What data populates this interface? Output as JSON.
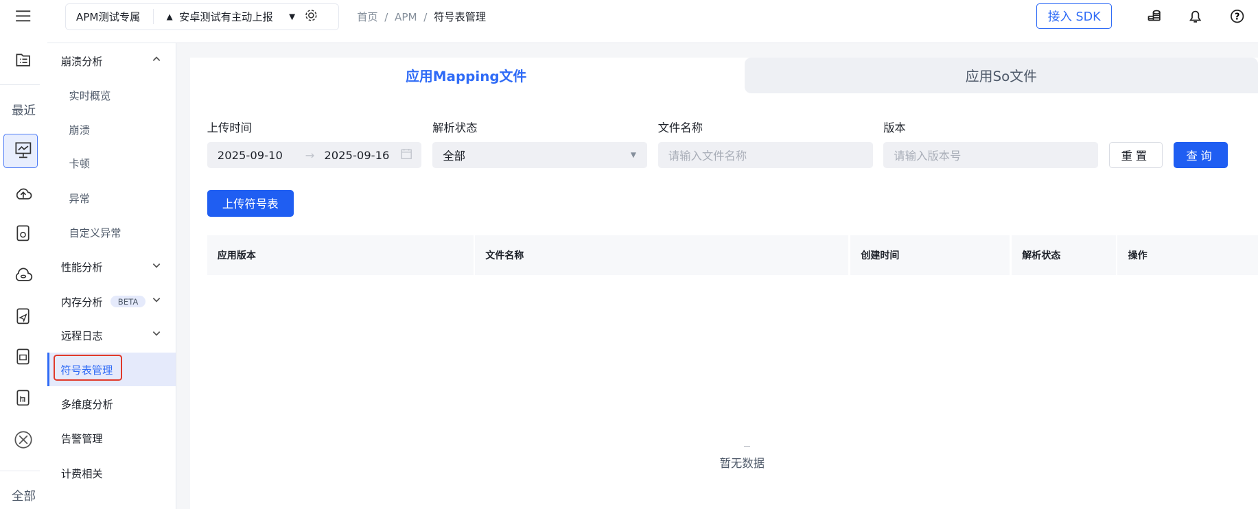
{
  "rail": {
    "recent_label": "最近",
    "all_label": "全部"
  },
  "header": {
    "project": "APM测试专属",
    "app": "安卓测试有主动上报",
    "breadcrumb": [
      "首页",
      "APM",
      "符号表管理"
    ],
    "sdk_button": "接入 SDK"
  },
  "sidebar": {
    "items": [
      {
        "label": "崩溃分析"
      },
      {
        "label": "实时概览"
      },
      {
        "label": "崩溃"
      },
      {
        "label": "卡顿"
      },
      {
        "label": "异常"
      },
      {
        "label": "自定义异常"
      },
      {
        "label": "性能分析"
      },
      {
        "label": "内存分析",
        "badge": "BETA"
      },
      {
        "label": "远程日志"
      },
      {
        "label": "符号表管理"
      },
      {
        "label": "多维度分析"
      },
      {
        "label": "告警管理"
      },
      {
        "label": "计费相关"
      }
    ]
  },
  "tabs": [
    {
      "label": "应用Mapping文件"
    },
    {
      "label": "应用So文件"
    }
  ],
  "filters": {
    "upload_time": {
      "label": "上传时间",
      "start": "2025-09-10",
      "end": "2025-09-16",
      "sep": "→"
    },
    "parse_status": {
      "label": "解析状态",
      "value": "全部"
    },
    "file_name": {
      "label": "文件名称",
      "placeholder": "请输入文件名称"
    },
    "version": {
      "label": "版本",
      "placeholder": "请输入版本号"
    },
    "reset": "重置",
    "query": "查询"
  },
  "upload_button": "上传符号表",
  "table": {
    "columns": [
      "应用版本",
      "文件名称",
      "创建时间",
      "解析状态",
      "操作"
    ],
    "empty": "暂无数据"
  },
  "colors": {
    "accent": "#2f6bf6",
    "highlight": "#e0392a"
  }
}
